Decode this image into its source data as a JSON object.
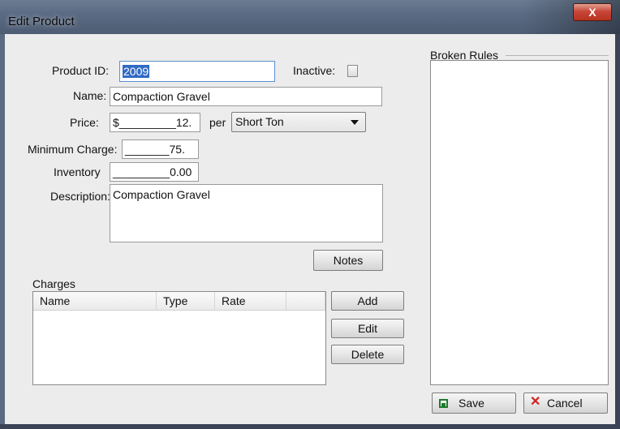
{
  "window": {
    "title": "Edit Product",
    "close_label": "X"
  },
  "form": {
    "product_id_label": "Product ID:",
    "product_id_value": "2009",
    "inactive_label": "Inactive:",
    "name_label": "Name:",
    "name_value": "Compaction Gravel",
    "price_label": "Price:",
    "price_value": "$_________12.",
    "per_label": "per",
    "unit_value": "Short Ton",
    "min_charge_label": "Minimum Charge:",
    "min_charge_value": "_______75.",
    "inventory_label": "Inventory",
    "inventory_value": "_________0.00",
    "description_label": "Description:",
    "description_value": "Compaction Gravel"
  },
  "buttons": {
    "notes": "Notes",
    "add": "Add",
    "edit": "Edit",
    "delete": "Delete",
    "save": "Save",
    "cancel": "Cancel"
  },
  "charges": {
    "label": "Charges",
    "columns": [
      "Name",
      "Type",
      "Rate"
    ]
  },
  "broken_rules": {
    "label": "Broken Rules"
  },
  "icons": {
    "save": "save-disk-icon",
    "cancel": "cancel-x-icon",
    "close": "close-icon",
    "dropdown": "chevron-down-icon"
  },
  "colors": {
    "selection": "#316ac5",
    "close_red": "#c8473a",
    "save_green": "#1d7a2c",
    "cancel_red": "#d21f1f"
  }
}
